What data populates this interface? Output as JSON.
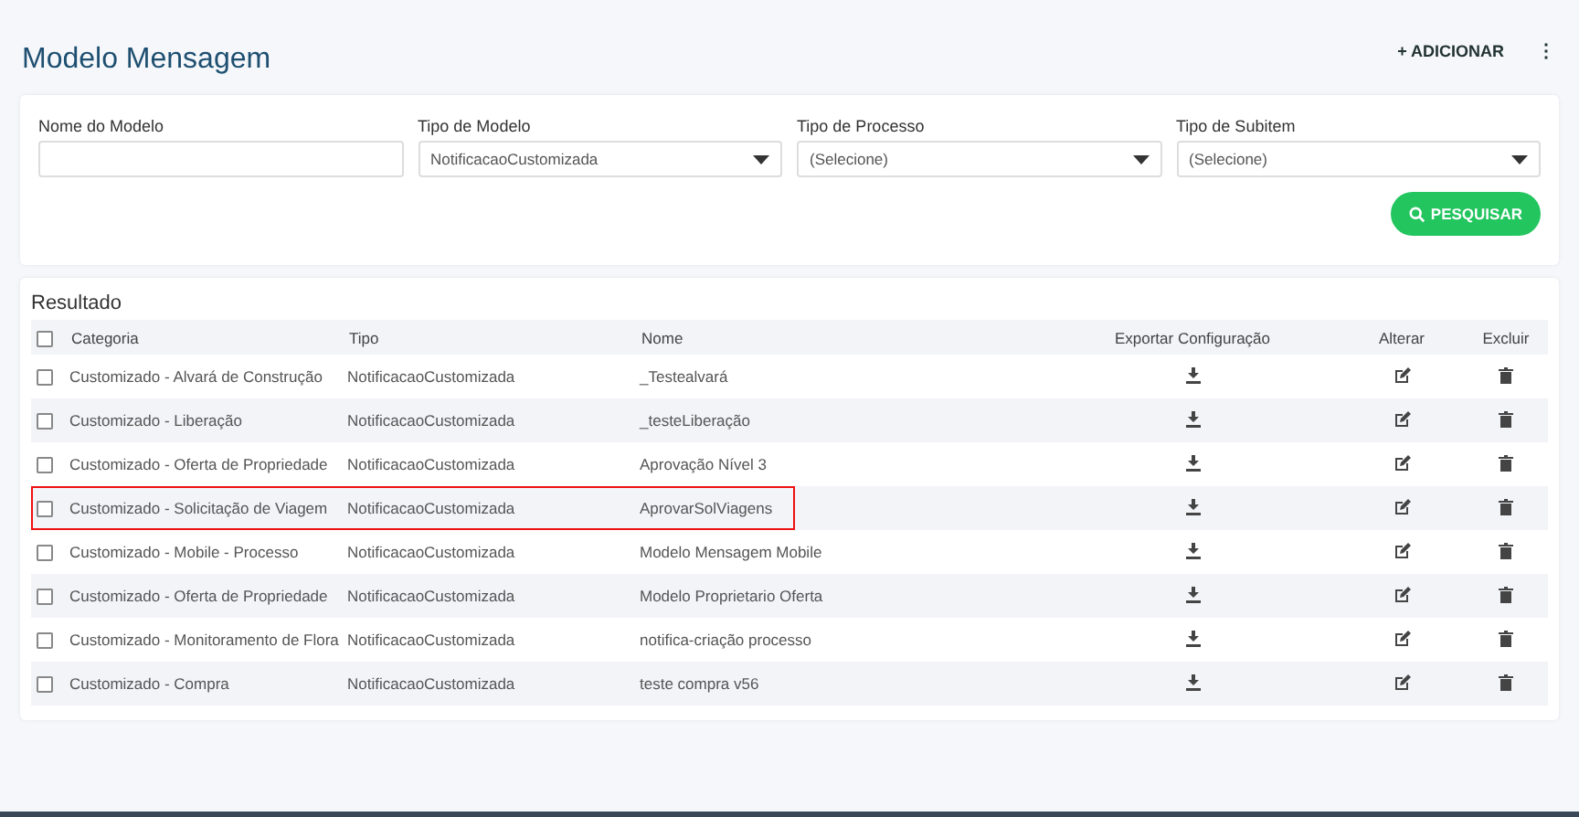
{
  "page_title": "Modelo Mensagem",
  "add_button": "+ ADICIONAR",
  "menu_button": "⋮",
  "filters": [
    {
      "label": "Nome do Modelo",
      "kind": "text"
    },
    {
      "label": "Tipo de Modelo",
      "kind": "select",
      "value": "NotificacaoCustomizada"
    },
    {
      "label": "Tipo de Processo",
      "kind": "select",
      "value": "(Selecione)"
    },
    {
      "label": "Tipo de Subitem",
      "kind": "select",
      "value": "(Selecione)"
    }
  ],
  "search_button": "PESQUISAR",
  "results": {
    "title": "Resultado",
    "header_checked": false,
    "columns": [
      "Categoria",
      "Tipo",
      "Nome",
      "Exportar Configuração",
      "Alterar",
      "Excluir"
    ],
    "rows": [
      {
        "categoria": "Customizado - Alvará de Construção",
        "tipo": "NotificacaoCustomizada",
        "nome": "_Testealvará",
        "checked": false,
        "highlighted": false
      },
      {
        "categoria": "Customizado - Liberação",
        "tipo": "NotificacaoCustomizada",
        "nome": "_testeLiberação",
        "checked": false,
        "highlighted": false
      },
      {
        "categoria": "Customizado - Oferta de Propriedade",
        "tipo": "NotificacaoCustomizada",
        "nome": "Aprovação Nível 3",
        "checked": false,
        "highlighted": false
      },
      {
        "categoria": "Customizado - Solicitação de Viagem",
        "tipo": "NotificacaoCustomizada",
        "nome": "AprovarSolViagens",
        "checked": false,
        "highlighted": true
      },
      {
        "categoria": "Customizado - Mobile - Processo",
        "tipo": "NotificacaoCustomizada",
        "nome": "Modelo Mensagem Mobile",
        "checked": false,
        "highlighted": false
      },
      {
        "categoria": "Customizado - Oferta de Propriedade",
        "tipo": "NotificacaoCustomizada",
        "nome": "Modelo Proprietario Oferta",
        "checked": false,
        "highlighted": false
      },
      {
        "categoria": "Customizado - Monitoramento de Flora",
        "tipo": "NotificacaoCustomizada",
        "nome": "notifica-criação processo",
        "checked": false,
        "highlighted": false
      },
      {
        "categoria": "Customizado - Compra",
        "tipo": "NotificacaoCustomizada",
        "nome": "teste compra v56",
        "checked": false,
        "highlighted": false
      }
    ]
  }
}
